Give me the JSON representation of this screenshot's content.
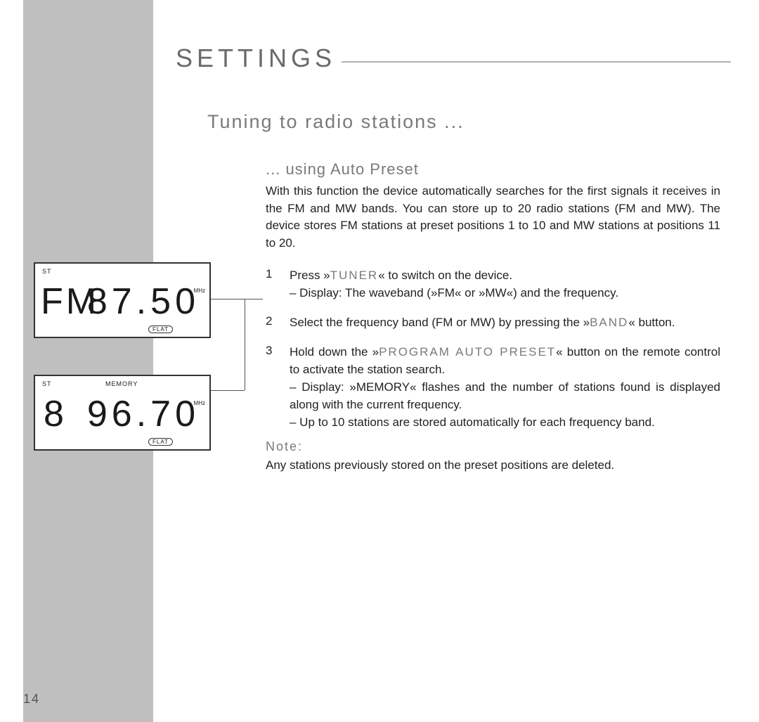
{
  "heading": "SETTINGS",
  "subheading": "Tuning to radio stations ...",
  "sub2": "... using Auto Preset",
  "intro": "With this function the device automatically searches for the first signals it receives in the FM and MW bands. You can store up to 20 radio stations (FM and MW). The device stores FM stations at preset positions 1 to 10 and MW stations at positions 11 to 20.",
  "steps": {
    "s1": {
      "n": "1",
      "a": "Press »",
      "btn": "TUNER",
      "b": "« to switch on the device."
    },
    "s1d": "– Display: The waveband (»FM« or »MW«) and the frequency.",
    "s2": {
      "n": "2",
      "a": "Select the frequency band (FM or MW) by pressing the »",
      "btn": "BAND",
      "b": "« button."
    },
    "s3": {
      "n": "3",
      "a": "Hold down the »",
      "btn": "PROGRAM AUTO PRESET",
      "b": "« button on the remote control to activate the station search."
    },
    "s3d1": "– Display: »MEMORY« flashes and the number of stations found is displayed along with the current frequency.",
    "s3d2": "– Up to 10 stations are stored automatically for each frequency band."
  },
  "noteLabel": "Note:",
  "noteText": "Any stations previously stored on the preset positions are deleted.",
  "lcd1": {
    "st": "ST",
    "band": "FM",
    "freq": "87.50",
    "unit": "MHz",
    "flat": "FLAT"
  },
  "lcd2": {
    "st": "ST",
    "mem": "MEMORY",
    "preset": "8",
    "freq": "96.70",
    "unit": "MHz",
    "flat": "FLAT"
  },
  "pageNumber": "14"
}
